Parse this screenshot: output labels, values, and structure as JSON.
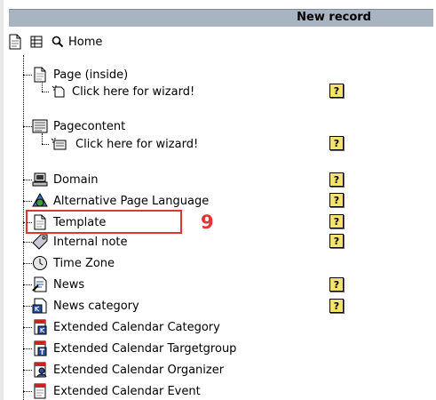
{
  "header": {
    "title": "New record"
  },
  "root": {
    "label": "Home"
  },
  "items": [
    {
      "label": "Page (inside)",
      "icon": "page-icon"
    },
    {
      "label": "Click here for wizard!",
      "icon": "wizard-page-icon",
      "help": "?"
    },
    {
      "label": "Pagecontent",
      "icon": "content-element-icon"
    },
    {
      "label": "Click here for wizard!",
      "icon": "wizard-content-icon",
      "help": "?"
    },
    {
      "label": "Domain",
      "icon": "domain-icon",
      "help": "?"
    },
    {
      "label": "Alternative Page Language",
      "icon": "language-icon",
      "help": "?"
    },
    {
      "label": "Template",
      "icon": "template-icon",
      "help": "?"
    },
    {
      "label": "Internal note",
      "icon": "note-icon",
      "help": "?"
    },
    {
      "label": "Time Zone",
      "icon": "timezone-icon"
    },
    {
      "label": "News",
      "icon": "news-icon",
      "help": "?"
    },
    {
      "label": "News category",
      "icon": "news-category-icon",
      "help": "?"
    },
    {
      "label": "Extended Calendar Category",
      "icon": "calendar-category-icon"
    },
    {
      "label": "Extended Calendar Targetgroup",
      "icon": "calendar-targetgroup-icon"
    },
    {
      "label": "Extended Calendar Organizer",
      "icon": "calendar-organizer-icon"
    },
    {
      "label": "Extended Calendar Event",
      "icon": "calendar-event-icon"
    }
  ],
  "annotation": {
    "step": "9"
  },
  "colors": {
    "header_bg": "#a9b4c2",
    "highlight": "#e33333",
    "help_bg": "#f4e36c"
  }
}
